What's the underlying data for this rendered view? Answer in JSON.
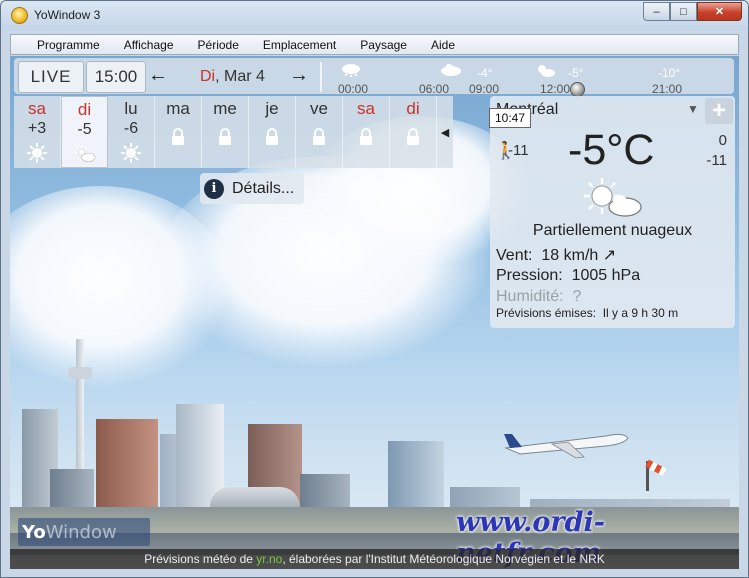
{
  "window": {
    "title": "YoWindow 3"
  },
  "menu": [
    "Programme",
    "Affichage",
    "Période",
    "Emplacement",
    "Paysage",
    "Aide"
  ],
  "topbar": {
    "live_label": "LIVE",
    "time": "15:00",
    "date_day": "Di",
    "date_rest": ", Mar 4",
    "timeline": [
      {
        "label": "00:00",
        "temp": ""
      },
      {
        "label": "06:00",
        "temp": ""
      },
      {
        "label": "09:00",
        "temp": "-4°"
      },
      {
        "label": "12:00",
        "temp": "-5°"
      },
      {
        "label": "21:00",
        "temp": "-10°"
      }
    ]
  },
  "days": [
    {
      "name": "sa",
      "temp": "+3",
      "icon": "sun-icon",
      "red": true,
      "locked": false
    },
    {
      "name": "di",
      "temp": "-5",
      "icon": "partly-cloudy-icon",
      "red": true,
      "locked": false,
      "selected": true
    },
    {
      "name": "lu",
      "temp": "-6",
      "icon": "sun-icon",
      "red": false,
      "locked": false
    },
    {
      "name": "ma",
      "temp": "",
      "icon": "lock-icon",
      "red": false,
      "locked": true
    },
    {
      "name": "me",
      "temp": "",
      "icon": "lock-icon",
      "red": false,
      "locked": true
    },
    {
      "name": "je",
      "temp": "",
      "icon": "lock-icon",
      "red": false,
      "locked": true
    },
    {
      "name": "ve",
      "temp": "",
      "icon": "lock-icon",
      "red": false,
      "locked": true
    },
    {
      "name": "sa",
      "temp": "",
      "icon": "lock-icon",
      "red": true,
      "locked": true
    },
    {
      "name": "di",
      "temp": "",
      "icon": "lock-icon",
      "red": true,
      "locked": true
    }
  ],
  "details_label": "Détails...",
  "panel": {
    "location": "Montréal",
    "time_tooltip": "10:47",
    "add_label": "+",
    "feels_like": "-11",
    "temperature": "-5°C",
    "high": "0",
    "low": "-11",
    "condition": "Partiellement nuageux",
    "wind_label": "Vent:",
    "wind_value": "18 km/h",
    "pressure_label": "Pression:",
    "pressure_value": "1005 hPa",
    "humidity_label": "Humidité:",
    "humidity_value": "?",
    "issued_label": "Prévisions émises:",
    "issued_value": "Il y a 9 h 30 m"
  },
  "logo": {
    "yo": "Yo",
    "rest": "Window"
  },
  "watermark": "www.ordi-netfr.com",
  "credits": {
    "before": "Prévisions météo de ",
    "link": "yr.no",
    "after": ", élaborées par l'Institut Météorologique Norvégien et le NRK"
  },
  "colors": {
    "accent_red": "#c9322a",
    "credit_link": "#7ac943"
  }
}
